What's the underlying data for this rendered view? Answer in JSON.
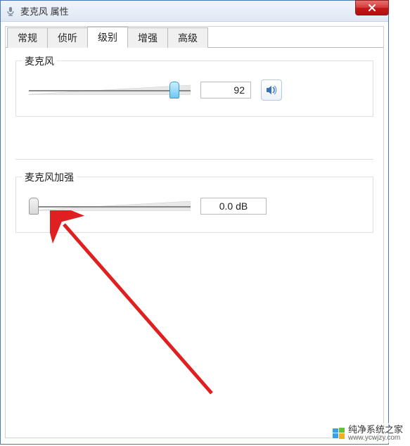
{
  "window": {
    "title": "麦克风 属性"
  },
  "tabs": {
    "t0": "常规",
    "t1": "侦听",
    "t2": "级别",
    "t3": "增强",
    "t4": "高级"
  },
  "microphone": {
    "label": "麦克风",
    "value": "92",
    "slider_percent": 92
  },
  "boost": {
    "label": "麦克风加强",
    "value": "0.0 dB",
    "slider_percent": 0
  },
  "watermark": {
    "brand": "纯净系统之家",
    "url": "www.ycwjzy.com"
  }
}
